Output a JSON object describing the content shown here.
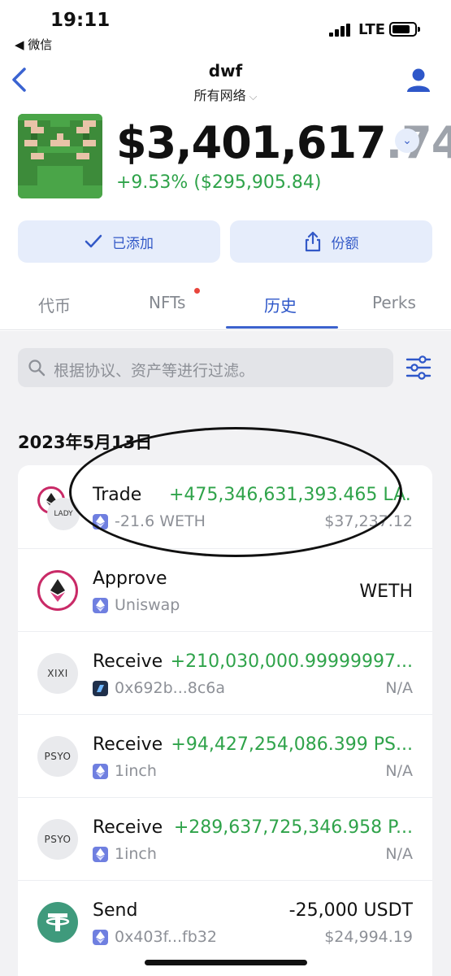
{
  "status_bar": {
    "time": "19:11",
    "back_app": "◀ 微信",
    "network": "LTE"
  },
  "header": {
    "wallet_name": "dwf",
    "network_label": "所有网络",
    "network_chevron": "⌵"
  },
  "balance": {
    "main": "$3,401,617",
    "cents": ".74",
    "change": "+9.53% ($295,905.84)",
    "toggle_icon": "chevron-down-icon"
  },
  "actions": {
    "added_label": "已添加",
    "share_label": "份额"
  },
  "tabs": [
    {
      "label": "代币"
    },
    {
      "label": "NFTs"
    },
    {
      "label": "历史"
    },
    {
      "label": "Perks"
    }
  ],
  "active_tab": "历史",
  "search": {
    "placeholder": "根据协议、资产等进行过滤。"
  },
  "history": {
    "date": "2023年5月13日",
    "items": [
      {
        "title": "Trade",
        "icon_label": "LADY",
        "sub": "-21.6 WETH",
        "amount": "+475,346,631,393.465 LA...",
        "value": "$37,237.12"
      },
      {
        "title": "Approve",
        "icon_label": "",
        "sub": "Uniswap",
        "amount": "WETH",
        "value": ""
      },
      {
        "title": "Receive",
        "icon_label": "XIXI",
        "sub": "0x692b...8c6a",
        "amount": "+210,030,000.99999997...",
        "value": "N/A"
      },
      {
        "title": "Receive",
        "icon_label": "PSYO",
        "sub": "1inch",
        "amount": "+94,427,254,086.399 PS...",
        "value": "N/A"
      },
      {
        "title": "Receive",
        "icon_label": "PSYO",
        "sub": "1inch",
        "amount": "+289,637,725,346.958 P...",
        "value": "N/A"
      },
      {
        "title": "Send",
        "icon_label": "",
        "sub": "0x403f...fb32",
        "amount": "-25,000 USDT",
        "value": "$24,994.19"
      }
    ]
  },
  "colors": {
    "accent": "#2e57c9",
    "positive": "#2fa34a",
    "button_bg": "#e6edfb",
    "content_bg": "#f2f2f4"
  }
}
